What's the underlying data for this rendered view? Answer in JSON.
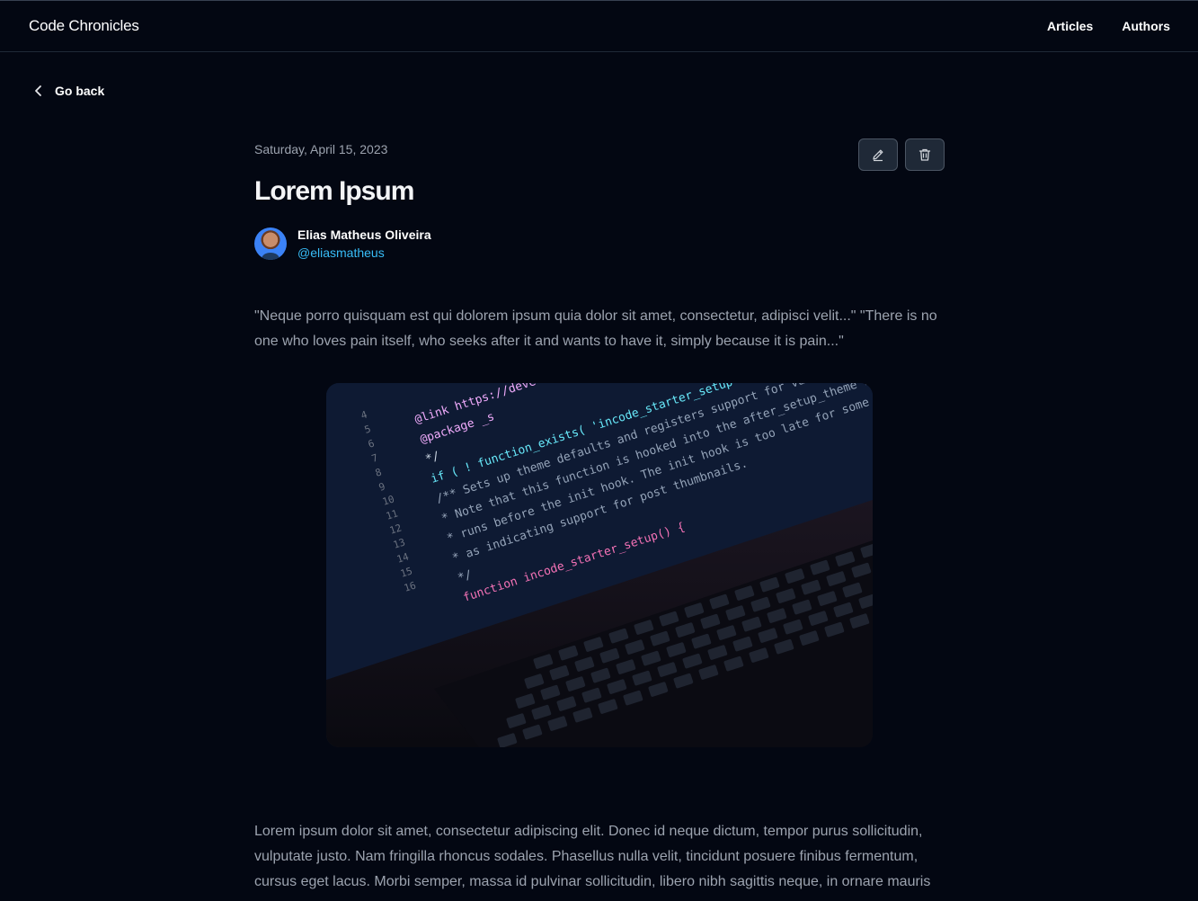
{
  "header": {
    "brand": "Code Chronicles",
    "nav": [
      {
        "label": "Articles"
      },
      {
        "label": "Authors"
      }
    ]
  },
  "back": {
    "label": "Go back"
  },
  "article": {
    "date": "Saturday, April 15, 2023",
    "title": "Lorem Ipsum",
    "author": {
      "name": "Elias Matheus Oliveira",
      "handle": "@eliasmatheus"
    },
    "quote": "\"Neque porro quisquam est qui dolorem ipsum quia dolor sit amet, consectetur, adipisci velit...\" \"There is no one who loves pain itself, who seeks after it and wants to have it, simply because it is pain...\"",
    "body": "Lorem ipsum dolor sit amet, consectetur adipiscing elit. Donec id neque dictum, tempor purus sollicitudin, vulputate justo. Nam fringilla rhoncus sodales. Phasellus nulla velit, tincidunt posuere finibus fermentum, cursus eget lacus. Morbi semper, massa id pulvinar sollicitudin, libero nibh sagittis neque, in ornare mauris",
    "actions": [
      {
        "icon": "pencil-icon"
      },
      {
        "icon": "trash-icon"
      }
    ],
    "hero_code": {
      "line_numbers": [
        "4",
        "5",
        "6",
        "7",
        "8",
        "9",
        "10",
        "11",
        "12",
        "13",
        "14",
        "15",
        "16"
      ],
      "lines": [
        "@link https://deve",
        "@package _s",
        "*/",
        "if ( ! function_exists( 'incode_starter_setup' ) ) :",
        "/** Sets up theme defaults and registers support for various WordPress features.",
        " * Note that this function is hooked into the after_setup_theme hook, which",
        " * runs before the init hook. The init hook is too late for some features, such",
        " * as indicating support for post thumbnails.",
        " */",
        "function incode_starter_setup() {"
      ]
    }
  }
}
